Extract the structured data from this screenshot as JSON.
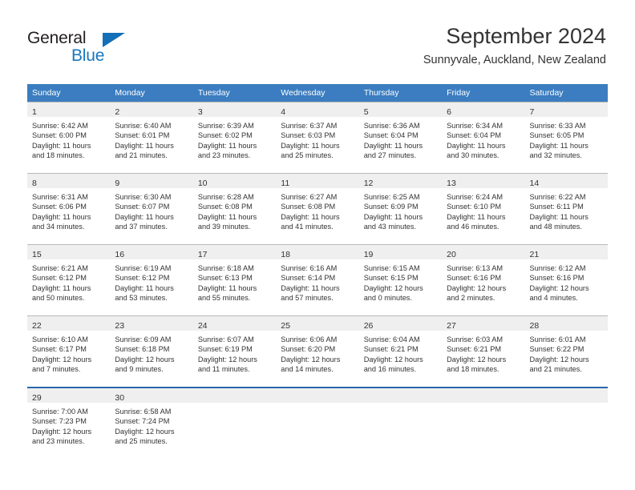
{
  "brand": {
    "name_part1": "General",
    "name_part2": "Blue",
    "triangle_color": "#136fb7",
    "blue_color": "#1878be",
    "dark_color": "#231f20"
  },
  "header": {
    "title": "September 2024",
    "subtitle": "Sunnyvale, Auckland, New Zealand"
  },
  "theme": {
    "header_row_bg": "#3b7dc0",
    "day_band_bg": "#efefef",
    "row_border": "#b8b8b8",
    "last_row_border": "#2a68ae",
    "text": "#333333"
  },
  "weekday_headers": [
    "Sunday",
    "Monday",
    "Tuesday",
    "Wednesday",
    "Thursday",
    "Friday",
    "Saturday"
  ],
  "weeks": [
    [
      {
        "day": "1",
        "sunrise": "Sunrise: 6:42 AM",
        "sunset": "Sunset: 6:00 PM",
        "daylight_1": "Daylight: 11 hours",
        "daylight_2": "and 18 minutes."
      },
      {
        "day": "2",
        "sunrise": "Sunrise: 6:40 AM",
        "sunset": "Sunset: 6:01 PM",
        "daylight_1": "Daylight: 11 hours",
        "daylight_2": "and 21 minutes."
      },
      {
        "day": "3",
        "sunrise": "Sunrise: 6:39 AM",
        "sunset": "Sunset: 6:02 PM",
        "daylight_1": "Daylight: 11 hours",
        "daylight_2": "and 23 minutes."
      },
      {
        "day": "4",
        "sunrise": "Sunrise: 6:37 AM",
        "sunset": "Sunset: 6:03 PM",
        "daylight_1": "Daylight: 11 hours",
        "daylight_2": "and 25 minutes."
      },
      {
        "day": "5",
        "sunrise": "Sunrise: 6:36 AM",
        "sunset": "Sunset: 6:04 PM",
        "daylight_1": "Daylight: 11 hours",
        "daylight_2": "and 27 minutes."
      },
      {
        "day": "6",
        "sunrise": "Sunrise: 6:34 AM",
        "sunset": "Sunset: 6:04 PM",
        "daylight_1": "Daylight: 11 hours",
        "daylight_2": "and 30 minutes."
      },
      {
        "day": "7",
        "sunrise": "Sunrise: 6:33 AM",
        "sunset": "Sunset: 6:05 PM",
        "daylight_1": "Daylight: 11 hours",
        "daylight_2": "and 32 minutes."
      }
    ],
    [
      {
        "day": "8",
        "sunrise": "Sunrise: 6:31 AM",
        "sunset": "Sunset: 6:06 PM",
        "daylight_1": "Daylight: 11 hours",
        "daylight_2": "and 34 minutes."
      },
      {
        "day": "9",
        "sunrise": "Sunrise: 6:30 AM",
        "sunset": "Sunset: 6:07 PM",
        "daylight_1": "Daylight: 11 hours",
        "daylight_2": "and 37 minutes."
      },
      {
        "day": "10",
        "sunrise": "Sunrise: 6:28 AM",
        "sunset": "Sunset: 6:08 PM",
        "daylight_1": "Daylight: 11 hours",
        "daylight_2": "and 39 minutes."
      },
      {
        "day": "11",
        "sunrise": "Sunrise: 6:27 AM",
        "sunset": "Sunset: 6:08 PM",
        "daylight_1": "Daylight: 11 hours",
        "daylight_2": "and 41 minutes."
      },
      {
        "day": "12",
        "sunrise": "Sunrise: 6:25 AM",
        "sunset": "Sunset: 6:09 PM",
        "daylight_1": "Daylight: 11 hours",
        "daylight_2": "and 43 minutes."
      },
      {
        "day": "13",
        "sunrise": "Sunrise: 6:24 AM",
        "sunset": "Sunset: 6:10 PM",
        "daylight_1": "Daylight: 11 hours",
        "daylight_2": "and 46 minutes."
      },
      {
        "day": "14",
        "sunrise": "Sunrise: 6:22 AM",
        "sunset": "Sunset: 6:11 PM",
        "daylight_1": "Daylight: 11 hours",
        "daylight_2": "and 48 minutes."
      }
    ],
    [
      {
        "day": "15",
        "sunrise": "Sunrise: 6:21 AM",
        "sunset": "Sunset: 6:12 PM",
        "daylight_1": "Daylight: 11 hours",
        "daylight_2": "and 50 minutes."
      },
      {
        "day": "16",
        "sunrise": "Sunrise: 6:19 AM",
        "sunset": "Sunset: 6:12 PM",
        "daylight_1": "Daylight: 11 hours",
        "daylight_2": "and 53 minutes."
      },
      {
        "day": "17",
        "sunrise": "Sunrise: 6:18 AM",
        "sunset": "Sunset: 6:13 PM",
        "daylight_1": "Daylight: 11 hours",
        "daylight_2": "and 55 minutes."
      },
      {
        "day": "18",
        "sunrise": "Sunrise: 6:16 AM",
        "sunset": "Sunset: 6:14 PM",
        "daylight_1": "Daylight: 11 hours",
        "daylight_2": "and 57 minutes."
      },
      {
        "day": "19",
        "sunrise": "Sunrise: 6:15 AM",
        "sunset": "Sunset: 6:15 PM",
        "daylight_1": "Daylight: 12 hours",
        "daylight_2": "and 0 minutes."
      },
      {
        "day": "20",
        "sunrise": "Sunrise: 6:13 AM",
        "sunset": "Sunset: 6:16 PM",
        "daylight_1": "Daylight: 12 hours",
        "daylight_2": "and 2 minutes."
      },
      {
        "day": "21",
        "sunrise": "Sunrise: 6:12 AM",
        "sunset": "Sunset: 6:16 PM",
        "daylight_1": "Daylight: 12 hours",
        "daylight_2": "and 4 minutes."
      }
    ],
    [
      {
        "day": "22",
        "sunrise": "Sunrise: 6:10 AM",
        "sunset": "Sunset: 6:17 PM",
        "daylight_1": "Daylight: 12 hours",
        "daylight_2": "and 7 minutes."
      },
      {
        "day": "23",
        "sunrise": "Sunrise: 6:09 AM",
        "sunset": "Sunset: 6:18 PM",
        "daylight_1": "Daylight: 12 hours",
        "daylight_2": "and 9 minutes."
      },
      {
        "day": "24",
        "sunrise": "Sunrise: 6:07 AM",
        "sunset": "Sunset: 6:19 PM",
        "daylight_1": "Daylight: 12 hours",
        "daylight_2": "and 11 minutes."
      },
      {
        "day": "25",
        "sunrise": "Sunrise: 6:06 AM",
        "sunset": "Sunset: 6:20 PM",
        "daylight_1": "Daylight: 12 hours",
        "daylight_2": "and 14 minutes."
      },
      {
        "day": "26",
        "sunrise": "Sunrise: 6:04 AM",
        "sunset": "Sunset: 6:21 PM",
        "daylight_1": "Daylight: 12 hours",
        "daylight_2": "and 16 minutes."
      },
      {
        "day": "27",
        "sunrise": "Sunrise: 6:03 AM",
        "sunset": "Sunset: 6:21 PM",
        "daylight_1": "Daylight: 12 hours",
        "daylight_2": "and 18 minutes."
      },
      {
        "day": "28",
        "sunrise": "Sunrise: 6:01 AM",
        "sunset": "Sunset: 6:22 PM",
        "daylight_1": "Daylight: 12 hours",
        "daylight_2": "and 21 minutes."
      }
    ],
    [
      {
        "day": "29",
        "sunrise": "Sunrise: 7:00 AM",
        "sunset": "Sunset: 7:23 PM",
        "daylight_1": "Daylight: 12 hours",
        "daylight_2": "and 23 minutes."
      },
      {
        "day": "30",
        "sunrise": "Sunrise: 6:58 AM",
        "sunset": "Sunset: 7:24 PM",
        "daylight_1": "Daylight: 12 hours",
        "daylight_2": "and 25 minutes."
      },
      {
        "day": "",
        "sunrise": "",
        "sunset": "",
        "daylight_1": "",
        "daylight_2": ""
      },
      {
        "day": "",
        "sunrise": "",
        "sunset": "",
        "daylight_1": "",
        "daylight_2": ""
      },
      {
        "day": "",
        "sunrise": "",
        "sunset": "",
        "daylight_1": "",
        "daylight_2": ""
      },
      {
        "day": "",
        "sunrise": "",
        "sunset": "",
        "daylight_1": "",
        "daylight_2": ""
      },
      {
        "day": "",
        "sunrise": "",
        "sunset": "",
        "daylight_1": "",
        "daylight_2": ""
      }
    ]
  ]
}
